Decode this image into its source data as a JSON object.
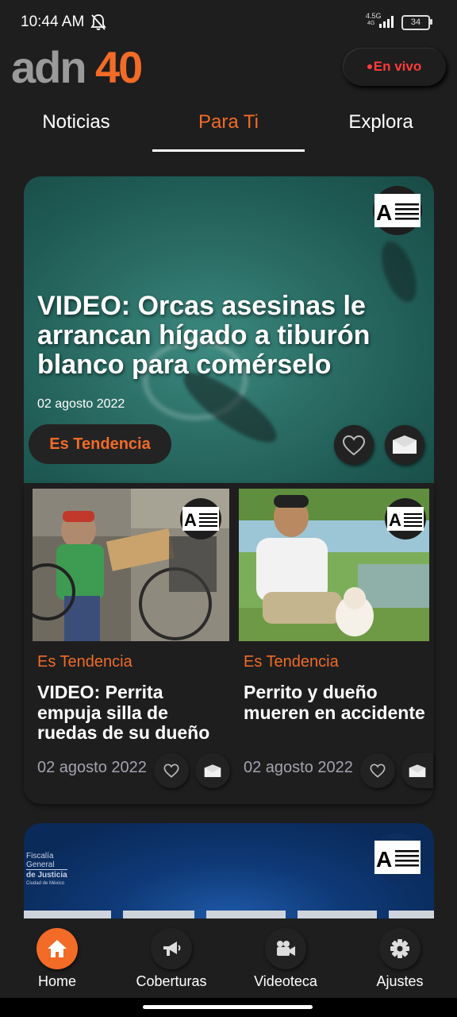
{
  "status_bar": {
    "time": "10:44 AM",
    "network": "4.5G",
    "network_sub": "4G",
    "battery": "34"
  },
  "header": {
    "logo_text": "adn40",
    "live_label": "En vivo"
  },
  "tabs": [
    {
      "label": "Noticias",
      "active": false
    },
    {
      "label": "Para Ti",
      "active": true
    },
    {
      "label": "Explora",
      "active": false
    }
  ],
  "hero": {
    "title": "VIDEO: Orcas asesinas le arrancan hígado a tiburón blanco para comérselo",
    "date": "02 agosto 2022",
    "badge": "Es Tendencia"
  },
  "cards": [
    {
      "tag": "Es Tendencia",
      "title": "VIDEO: Perrita empuja silla de ruedas de su dueño",
      "date": "02 agosto 2022"
    },
    {
      "tag": "Es Tendencia",
      "title": "Perrito y dueño mueren en accidente",
      "date": "02 agosto 2022"
    }
  ],
  "card3": {
    "org_line1": "Fiscalía",
    "org_line2": "General",
    "org_line3": "de Justicia",
    "org_line4": "Ciudad de México"
  },
  "bottom_nav": [
    {
      "label": "Home",
      "icon": "home-icon",
      "active": true
    },
    {
      "label": "Coberturas",
      "icon": "megaphone-icon",
      "active": false
    },
    {
      "label": "Videoteca",
      "icon": "video-camera-icon",
      "active": false
    },
    {
      "label": "Ajustes",
      "icon": "gear-icon",
      "active": false
    }
  ],
  "colors": {
    "accent": "#f26b27",
    "background": "#1e1e1e",
    "live": "#ff3b3b"
  }
}
